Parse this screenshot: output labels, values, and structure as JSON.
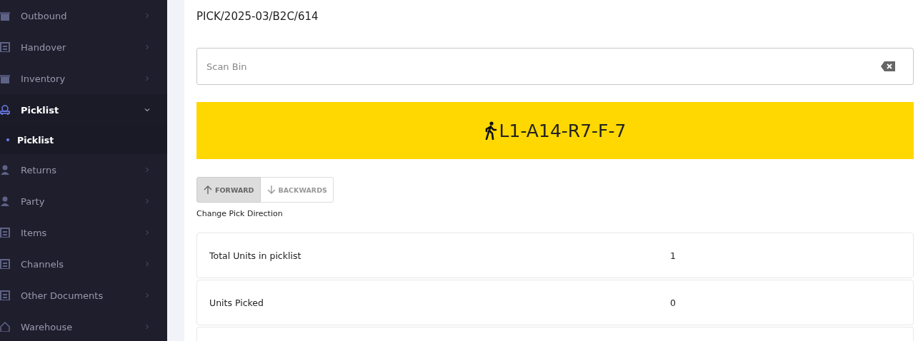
{
  "sidebar": {
    "items": [
      {
        "label": "Outbound",
        "kind": "box",
        "selected": false,
        "expanded": false
      },
      {
        "label": "Handover",
        "kind": "doc",
        "selected": false,
        "expanded": false
      },
      {
        "label": "Inventory",
        "kind": "box",
        "selected": false,
        "expanded": false
      },
      {
        "label": "Picklist",
        "kind": "cart",
        "selected": true,
        "expanded": true,
        "children": [
          {
            "label": "Picklist",
            "selected": true
          }
        ]
      },
      {
        "label": "Returns",
        "kind": "user",
        "selected": false,
        "expanded": false
      },
      {
        "label": "Party",
        "kind": "user",
        "selected": false,
        "expanded": false
      },
      {
        "label": "Items",
        "kind": "doc",
        "selected": false,
        "expanded": false
      },
      {
        "label": "Channels",
        "kind": "doc",
        "selected": false,
        "expanded": false
      },
      {
        "label": "Other Documents",
        "kind": "doc",
        "selected": false,
        "expanded": false
      },
      {
        "label": "Warehouse",
        "kind": "home",
        "selected": false,
        "expanded": false
      }
    ]
  },
  "page": {
    "title": "PICK/2025-03/B2C/614",
    "scan_field": {
      "placeholder": "Scan Bin"
    },
    "location_banner": {
      "text": "L1-A14-R7-F-7"
    },
    "direction": {
      "options": [
        {
          "label": "FORWARD",
          "kind": "up",
          "selected": true
        },
        {
          "label": "BACKWARDS",
          "kind": "down",
          "selected": false
        }
      ],
      "caption": "Change Pick Direction"
    },
    "stats": [
      {
        "label": "Total Units in picklist",
        "value": "1"
      },
      {
        "label": "Units Picked",
        "value": "0"
      }
    ]
  }
}
